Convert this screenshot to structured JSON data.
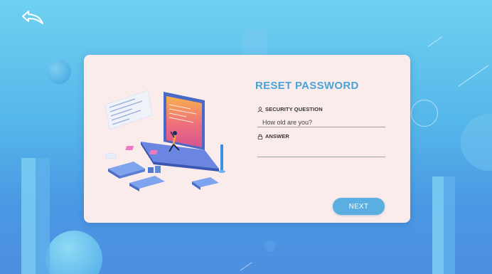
{
  "window": {
    "back_icon": "back-arrow-icon"
  },
  "colors": {
    "accent": "#5aaee0",
    "title": "#4aa3d8",
    "card_background": "#fbecec"
  },
  "reset": {
    "title": "RESET PASSWORD",
    "question_label": "SECURITY QUESTION",
    "question_icon": "user-icon",
    "question_value": "How old are you?",
    "answer_label": "ANSWER",
    "answer_icon": "lock-icon",
    "answer_value": "",
    "next_label": "NEXT"
  }
}
